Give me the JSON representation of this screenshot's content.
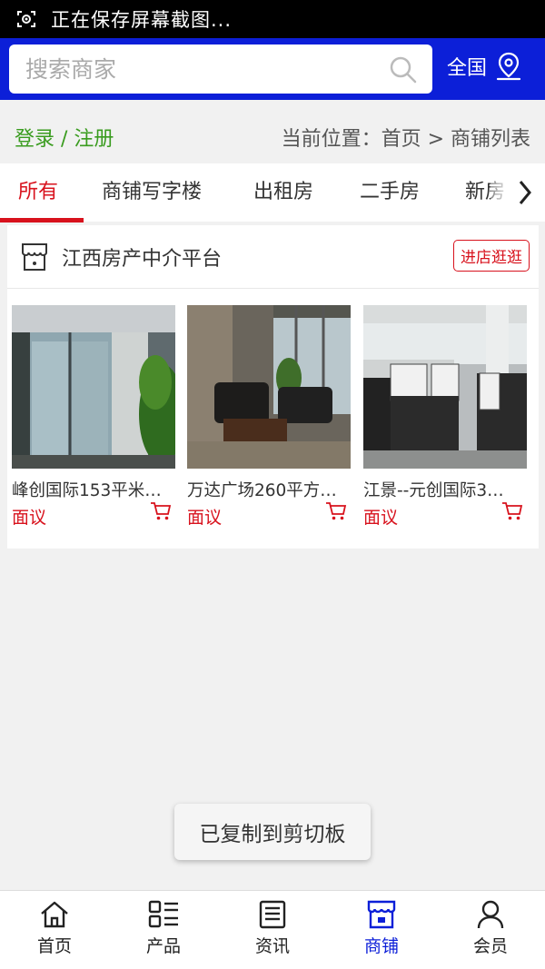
{
  "status_bar": {
    "text": "正在保存屏幕截图..."
  },
  "header": {
    "search_placeholder": "搜索商家",
    "region_label": "全国"
  },
  "breadcrumb": {
    "login_label": "登录 / 注册",
    "location_text": "当前位置：首页 > 商铺列表"
  },
  "tabs": [
    {
      "label": "所有"
    },
    {
      "label": "商铺写字楼"
    },
    {
      "label": "出租房"
    },
    {
      "label": "二手房"
    },
    {
      "label": "新房"
    }
  ],
  "shop": {
    "name": "江西房产中介平台",
    "visit_button": "进店逛逛",
    "products": [
      {
        "title": "峰创国际153平米…",
        "price": "面议"
      },
      {
        "title": "万达广场260平方…",
        "price": "面议"
      },
      {
        "title": "江景--元创国际3…",
        "price": "面议"
      }
    ]
  },
  "toast": {
    "text": "已复制到剪切板"
  },
  "bottom_nav": [
    {
      "label": "首页"
    },
    {
      "label": "产品"
    },
    {
      "label": "资讯"
    },
    {
      "label": "商铺"
    },
    {
      "label": "会员"
    }
  ],
  "colors": {
    "header_blue": "#0c1fd8",
    "accent_red": "#d8121d",
    "login_green": "#3a9c1f"
  }
}
